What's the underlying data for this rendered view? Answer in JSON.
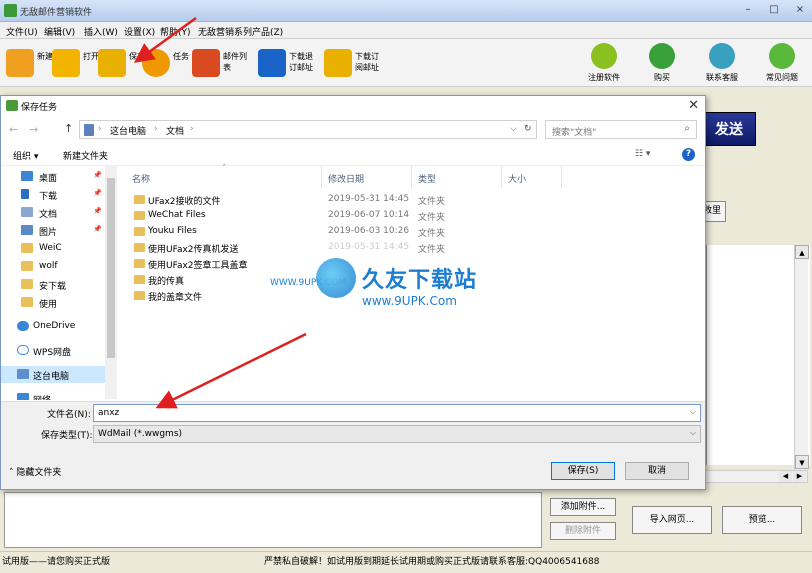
{
  "app": {
    "title": "无敌邮件营销软件",
    "window_buttons": [
      "–",
      "□",
      "×"
    ]
  },
  "menu": [
    "文件(U)",
    "编辑(V)",
    "插入(W)",
    "设置(X)",
    "帮助(Y)",
    "无敌营销系列产品(Z)"
  ],
  "toolbar": {
    "buttons": [
      {
        "label": "新建",
        "icon": "new-mail-icon",
        "color": "#f0a020"
      },
      {
        "label": "打开",
        "icon": "open-folder-icon",
        "color": "#f3b400"
      },
      {
        "label": "保存",
        "icon": "save-icon",
        "color": "#e9b000"
      },
      {
        "label": "任务",
        "icon": "task-clock-icon",
        "color": "#f09800"
      },
      {
        "label": "邮件列表",
        "icon": "mail-list-icon",
        "color": "#d94a20"
      },
      {
        "label": "下载退订邮址",
        "icon": "download-unsub-icon",
        "color": "#1a63c9"
      },
      {
        "label": "下载订阅邮址",
        "icon": "download-sub-icon",
        "color": "#e9b000"
      }
    ],
    "right_buttons": [
      {
        "label": "注册软件",
        "icon": "pencil-icon",
        "color": "#8ac020"
      },
      {
        "label": "购买",
        "icon": "cart-icon",
        "color": "#3aa03a"
      },
      {
        "label": "联系客服",
        "icon": "globe-icon",
        "color": "#3aa0c0"
      },
      {
        "label": "常见问题",
        "icon": "question-icon",
        "color": "#5ab83a"
      }
    ]
  },
  "main": {
    "send_label": "发送",
    "side_btn": "救里",
    "add_attachment": "添加附件...",
    "delete_attachment": "删除附件",
    "import_web": "导入网页...",
    "preview": "预览..."
  },
  "status": {
    "left": "试用版——请您购买正式版",
    "mid": "严禁私自破解！如试用版到期延长试用期或购买正式版请联系客服:QQ4006541688"
  },
  "dialog": {
    "title": "保存任务",
    "nav_back": "←",
    "nav_fwd": "→",
    "nav_up": "↑",
    "breadcrumbs": [
      "这台电脑",
      "文档"
    ],
    "search_placeholder": "搜索\"文档\"",
    "organize": "组织 ▾",
    "new_folder": "新建文件夹",
    "columns": [
      "名称",
      "修改日期",
      "类型",
      "大小"
    ],
    "nav_items": [
      {
        "label": "桌面",
        "icon": "desktop-icon",
        "pin": true
      },
      {
        "label": "下载",
        "icon": "download-icon",
        "pin": true
      },
      {
        "label": "文档",
        "icon": "document-icon",
        "pin": true
      },
      {
        "label": "图片",
        "icon": "picture-icon",
        "pin": true
      },
      {
        "label": "WeiC",
        "icon": "folder-icon",
        "pin": false
      },
      {
        "label": "wolf",
        "icon": "folder-icon",
        "pin": false
      },
      {
        "label": "安下载",
        "icon": "folder-icon",
        "pin": false
      },
      {
        "label": "使用",
        "icon": "folder-icon",
        "pin": false
      },
      {
        "label": "OneDrive",
        "icon": "cloud-icon",
        "pin": false
      },
      {
        "label": "WPS网盘",
        "icon": "cloud-icon",
        "pin": false
      },
      {
        "label": "这台电脑",
        "icon": "computer-icon",
        "pin": false
      },
      {
        "label": "网络",
        "icon": "network-icon",
        "pin": false
      }
    ],
    "files": [
      {
        "name": "UFax2接收的文件",
        "date": "2019-05-31 14:45",
        "type": "文件夹"
      },
      {
        "name": "WeChat Files",
        "date": "2019-06-07 10:14",
        "type": "文件夹"
      },
      {
        "name": "Youku Files",
        "date": "2019-06-03 10:26",
        "type": "文件夹"
      },
      {
        "name": "使用UFax2传真机发送",
        "date": "2019-05-31 14:45",
        "type": "文件夹"
      },
      {
        "name": "使用UFax2签章工具盖章",
        "date": "",
        "type": ""
      },
      {
        "name": "我的传真",
        "date": "",
        "type": ""
      },
      {
        "name": "我的盖章文件",
        "date": "",
        "type": ""
      }
    ],
    "filename_label": "文件名(N):",
    "filename_value": "anxz",
    "filetype_label": "保存类型(T):",
    "filetype_value": "WdMail (*.wwgms)",
    "hide_folders": "隐藏文件夹",
    "save_btn": "保存(S)",
    "cancel_btn": "取消"
  },
  "watermark": {
    "cn": "久友下载站",
    "en": "www.9UPK.Com",
    "left": "WWW.9UPK.COM"
  },
  "colors": {
    "annotation_arrow": "#e02020",
    "accent": "#1d7ed0"
  }
}
